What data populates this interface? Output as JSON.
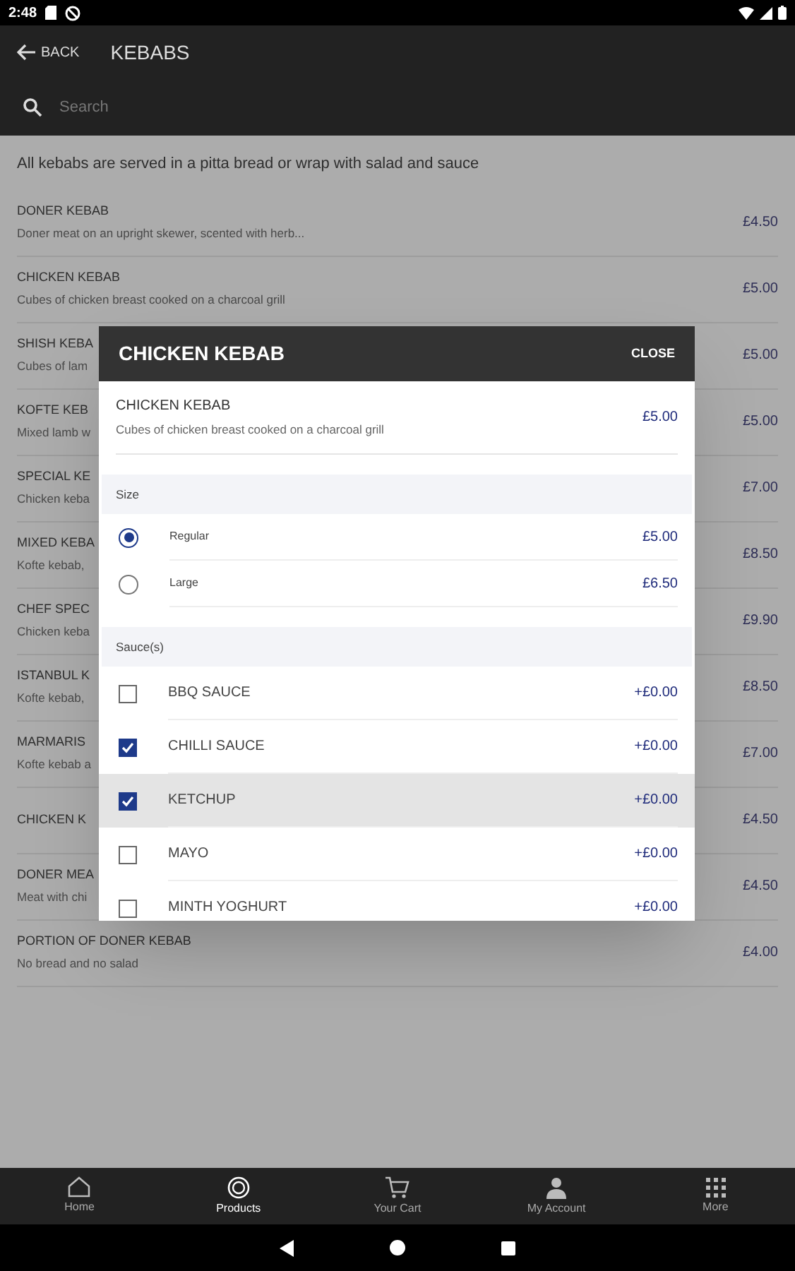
{
  "status_bar": {
    "time": "2:48"
  },
  "app_bar": {
    "back": "BACK",
    "title": "KEBABS",
    "search": {
      "placeholder": "Search"
    }
  },
  "category_note": "All kebabs are served in a pitta bread or wrap with salad and sauce",
  "items": [
    {
      "name": "DONER KEBAB",
      "description": "Doner meat on an upright skewer, scented with herb...",
      "price": "£4.50"
    },
    {
      "name": "CHICKEN KEBAB",
      "description": "Cubes of chicken breast cooked on a charcoal grill",
      "price": "£5.00"
    },
    {
      "name": "SHISH KEBA",
      "description": "Cubes of lam",
      "price": "£5.00"
    },
    {
      "name": "KOFTE KEB",
      "description": "Mixed lamb w",
      "price": "£5.00"
    },
    {
      "name": "SPECIAL KE",
      "description": "Chicken keba",
      "price": "£7.00"
    },
    {
      "name": "MIXED KEBA",
      "description": "Kofte kebab,",
      "price": "£8.50"
    },
    {
      "name": "CHEF SPEC",
      "description": "Chicken keba",
      "price": "£9.90"
    },
    {
      "name": "ISTANBUL K",
      "description": "Kofte kebab,",
      "price": "£8.50"
    },
    {
      "name": "MARMARIS",
      "description": "Kofte kebab a",
      "price": "£7.00"
    },
    {
      "name": "CHICKEN K",
      "price": "£4.50"
    },
    {
      "name": "DONER MEA",
      "description": "Meat with chi",
      "price": "£4.50"
    },
    {
      "name": "PORTION OF DONER KEBAB",
      "description": "No bread and no salad",
      "price": "£4.00"
    }
  ],
  "dialog": {
    "title": "CHICKEN KEBAB",
    "close": "CLOSE",
    "product": {
      "name": "CHICKEN KEBAB",
      "description": "Cubes of chicken breast cooked on a charcoal grill",
      "price": "£5.00"
    },
    "groups": [
      {
        "label": "Size",
        "kind": "radio",
        "options": [
          {
            "label": "Regular",
            "price": "£5.00",
            "selected": true
          },
          {
            "label": "Large",
            "price": "£6.50",
            "selected": false
          }
        ]
      },
      {
        "label": "Sauce(s)",
        "kind": "checkbox",
        "options": [
          {
            "label": "BBQ SAUCE",
            "price": "+£0.00",
            "checked": false,
            "highlighted": false
          },
          {
            "label": "CHILLI SAUCE",
            "price": "+£0.00",
            "checked": true,
            "highlighted": false
          },
          {
            "label": "KETCHUP",
            "price": "+£0.00",
            "checked": true,
            "highlighted": true
          },
          {
            "label": "MAYO",
            "price": "+£0.00",
            "checked": false,
            "highlighted": false
          },
          {
            "label": "MINTH YOGHURT",
            "price": "+£0.00",
            "checked": false,
            "highlighted": false
          }
        ]
      }
    ]
  },
  "bottom_nav": [
    {
      "label": "Home",
      "selected": false
    },
    {
      "label": "Products",
      "selected": true
    },
    {
      "label": "Your Cart",
      "selected": false
    },
    {
      "label": "My Account",
      "selected": false
    },
    {
      "label": "More",
      "selected": false
    }
  ]
}
